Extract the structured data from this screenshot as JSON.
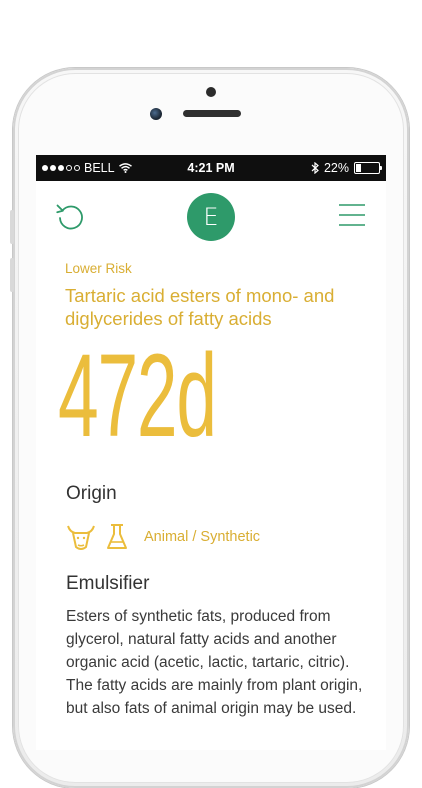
{
  "statusbar": {
    "carrier": "BELL",
    "time": "4:21 PM",
    "battery": "22%",
    "battery_level": 0.22
  },
  "header": {
    "logo_letter": "E",
    "icons": [
      "undo-icon",
      "menu-icon"
    ]
  },
  "additive": {
    "risk": "Lower Risk",
    "name": "Tartaric acid esters of mono- and diglycerides of fatty acids",
    "code": "472d"
  },
  "origin": {
    "title": "Origin",
    "icons": [
      "cow-icon",
      "flask-icon"
    ],
    "text": "Animal / Synthetic"
  },
  "function": {
    "title": "Emulsifier",
    "description": "Esters of synthetic fats, produced from glycerol, natural fatty acids and another organic acid (acetic, lactic, tartaric, citric). The fatty acids are mainly from plant origin, but also fats of animal origin may be used."
  },
  "colors": {
    "accent_green": "#2e9a6a",
    "accent_yellow": "#ebbd3c"
  }
}
